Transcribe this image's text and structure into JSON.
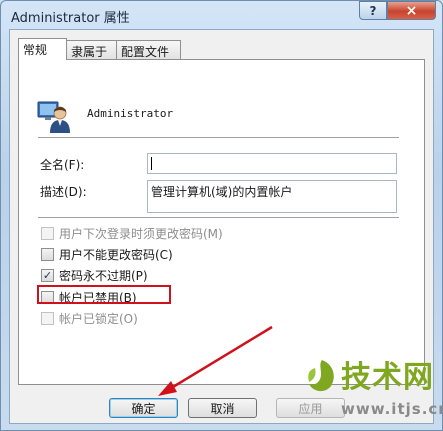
{
  "window": {
    "title": "Administrator 属性",
    "help_label": "?",
    "close_label": "×"
  },
  "tabs": [
    {
      "label": "常规",
      "active": true
    },
    {
      "label": "隶属于",
      "active": false
    },
    {
      "label": "配置文件",
      "active": false
    }
  ],
  "user": {
    "name": "Administrator",
    "icon": "user-icon"
  },
  "fields": {
    "fullname_label": "全名(F):",
    "fullname_value": "",
    "description_label": "描述(D):",
    "description_value": "管理计算机(域)的内置帐户"
  },
  "checkboxes": [
    {
      "label": "用户下次登录时须更改密码(M)",
      "checked": false,
      "disabled": true
    },
    {
      "label": "用户不能更改密码(C)",
      "checked": false,
      "disabled": false
    },
    {
      "label": "密码永不过期(P)",
      "checked": true,
      "disabled": false
    },
    {
      "label": "帐户已禁用(B)",
      "checked": false,
      "disabled": false
    },
    {
      "label": "帐户已锁定(O)",
      "checked": false,
      "disabled": true
    }
  ],
  "buttons": {
    "ok": "确定",
    "cancel": "取消",
    "apply": "应用"
  },
  "watermark": {
    "brand": "技术网",
    "url": "www.itjs.cn"
  },
  "colors": {
    "highlight": "#d0101a",
    "arrow": "#d0101a",
    "brand": "#7fa71f"
  }
}
